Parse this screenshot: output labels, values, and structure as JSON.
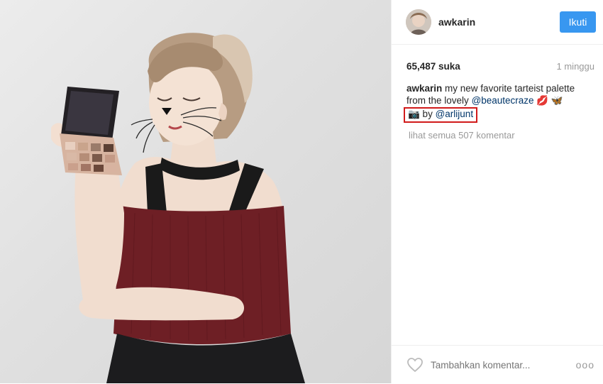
{
  "post": {
    "author": {
      "username": "awkarin"
    },
    "follow_label": "Ikuti",
    "likes": "65,487 suka",
    "posted_ago": "1 minggu",
    "caption": {
      "username": "awkarin",
      "text_1": "my new favorite tarteist palette from the lovely",
      "mention_1": "@beautecraze",
      "emoji": "💋 🦋",
      "credit_prefix": "📷 by",
      "mention_2": "@arlijunt"
    },
    "view_all_comments": "lihat semua 507 komentar",
    "comment_placeholder": "Tambahkan komentar...",
    "more_label": "ooo",
    "colors": {
      "accent": "#3897f0",
      "highlight_box": "#d11b1b",
      "dress": "#6e1f25",
      "mention": "#003569"
    },
    "icons": [
      "heart-icon",
      "more-options-icon",
      "camera-emoji"
    ]
  }
}
